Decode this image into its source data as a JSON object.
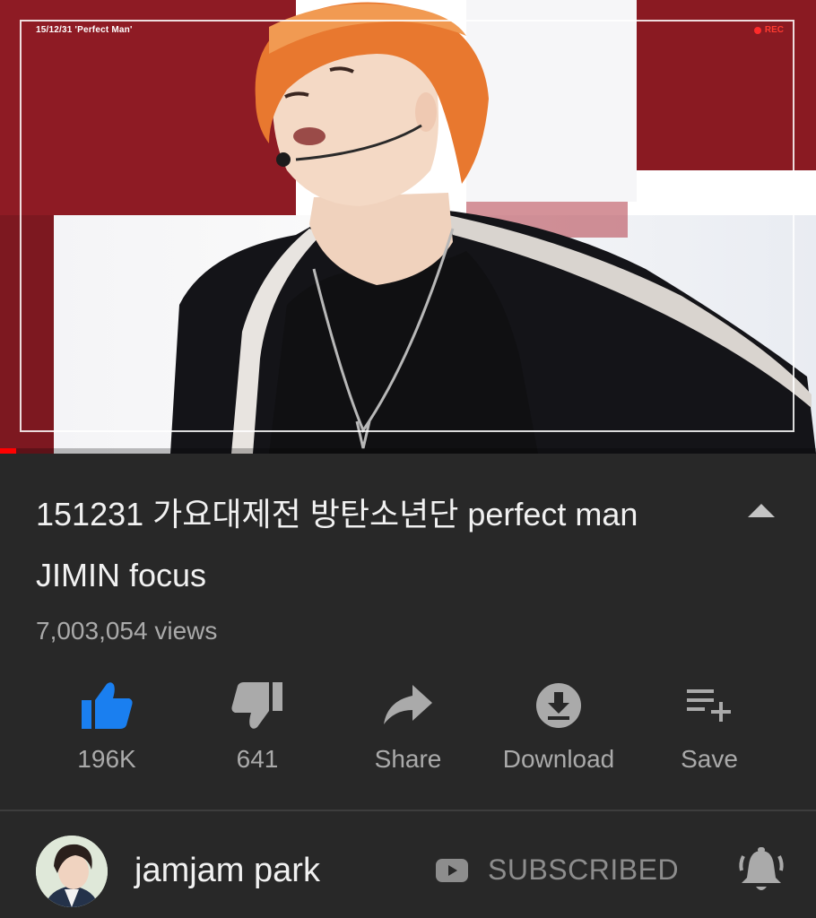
{
  "video": {
    "overlay_date_title": "15/12/31 'Perfect Man'",
    "overlay_rec": "REC",
    "progress_fraction": 0.02,
    "accent_color": "#ff0000"
  },
  "title": "151231 가요대제전 방탄소년단 perfect man JIMIN focus",
  "views": "7,003,054 views",
  "actions": {
    "like": {
      "icon": "thumbs-up-icon",
      "label": "196K",
      "color": "#3ea6ff"
    },
    "dislike": {
      "icon": "thumbs-down-icon",
      "label": "641"
    },
    "share": {
      "icon": "share-arrow-icon",
      "label": "Share"
    },
    "download": {
      "icon": "download-icon",
      "label": "Download"
    },
    "save": {
      "icon": "playlist-add-icon",
      "label": "Save"
    }
  },
  "channel": {
    "name": "jamjam park",
    "subscribe_label": "SUBSCRIBED"
  }
}
